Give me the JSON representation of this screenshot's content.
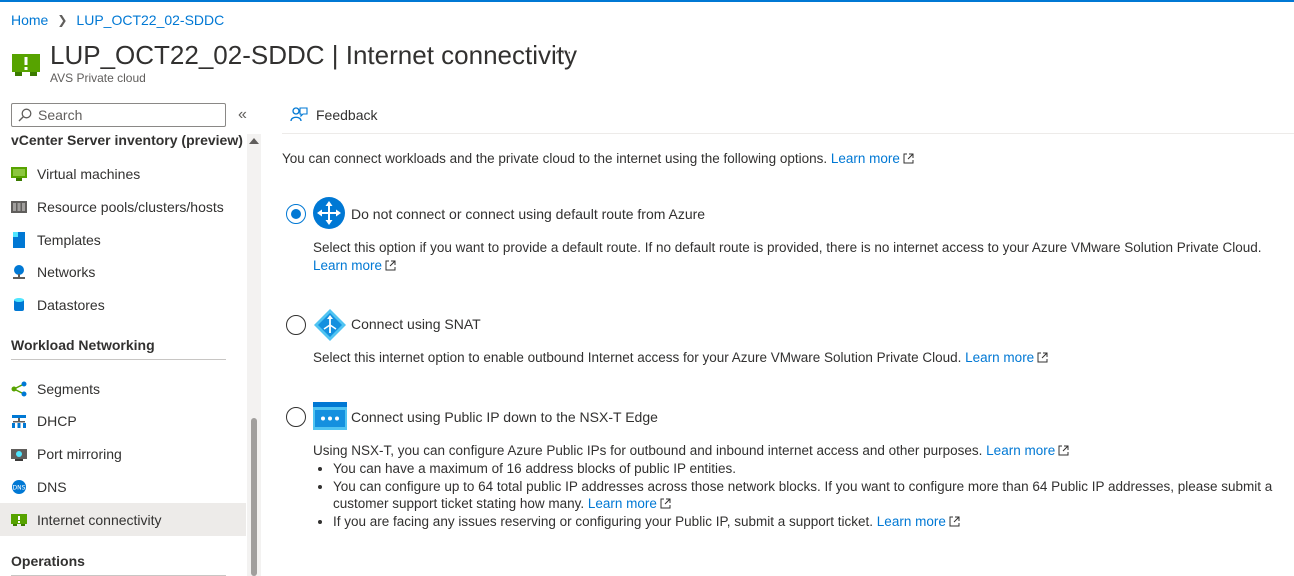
{
  "breadcrumb": {
    "home": "Home",
    "resource": "LUP_OCT22_02-SDDC"
  },
  "header": {
    "title": "LUP_OCT22_02-SDDC | Internet connectivity",
    "subtitle": "AVS Private cloud",
    "more": "···"
  },
  "sidebar": {
    "search_placeholder": "Search",
    "collapse_glyph": "«",
    "sections": [
      {
        "title": "vCenter Server inventory (preview)",
        "items": [
          "Virtual machines",
          "Resource pools/clusters/hosts",
          "Templates",
          "Networks",
          "Datastores"
        ]
      },
      {
        "title": "Workload Networking",
        "items": [
          "Segments",
          "DHCP",
          "Port mirroring",
          "DNS",
          "Internet connectivity"
        ]
      },
      {
        "title": "Operations",
        "items": []
      }
    ],
    "active_item": "Internet connectivity"
  },
  "command_bar": {
    "feedback_label": "Feedback"
  },
  "main": {
    "intro": "You can connect workloads and the private cloud to the internet using the following options.",
    "learn_more": "Learn more",
    "selected_option": 0,
    "options": [
      {
        "label": "Do not connect or connect using default route from Azure",
        "description": "Select this option if you want to provide a default route. If no default route is provided, there is no internet access to your Azure VMware Solution Private Cloud."
      },
      {
        "label": "Connect using SNAT",
        "description": "Select this internet option to enable outbound Internet access for your Azure VMware Solution Private Cloud."
      },
      {
        "label": "Connect using Public IP down to the NSX-T Edge",
        "description": "Using NSX-T, you can configure Azure Public IPs for outbound and inbound internet access and other purposes.",
        "bullets": [
          "You can have a maximum of 16 address blocks of public IP entities.",
          "You can configure up to 64 total public IP addresses across those network blocks. If you want to configure more than 64 Public IP addresses, please submit a customer support ticket stating how many.",
          "If you are facing any issues reserving or configuring your Public IP, submit a support ticket."
        ]
      }
    ]
  },
  "colors": {
    "accent": "#0078d4",
    "text": "#323130",
    "secondary": "#605e5c",
    "active_bg": "#edebe9"
  }
}
